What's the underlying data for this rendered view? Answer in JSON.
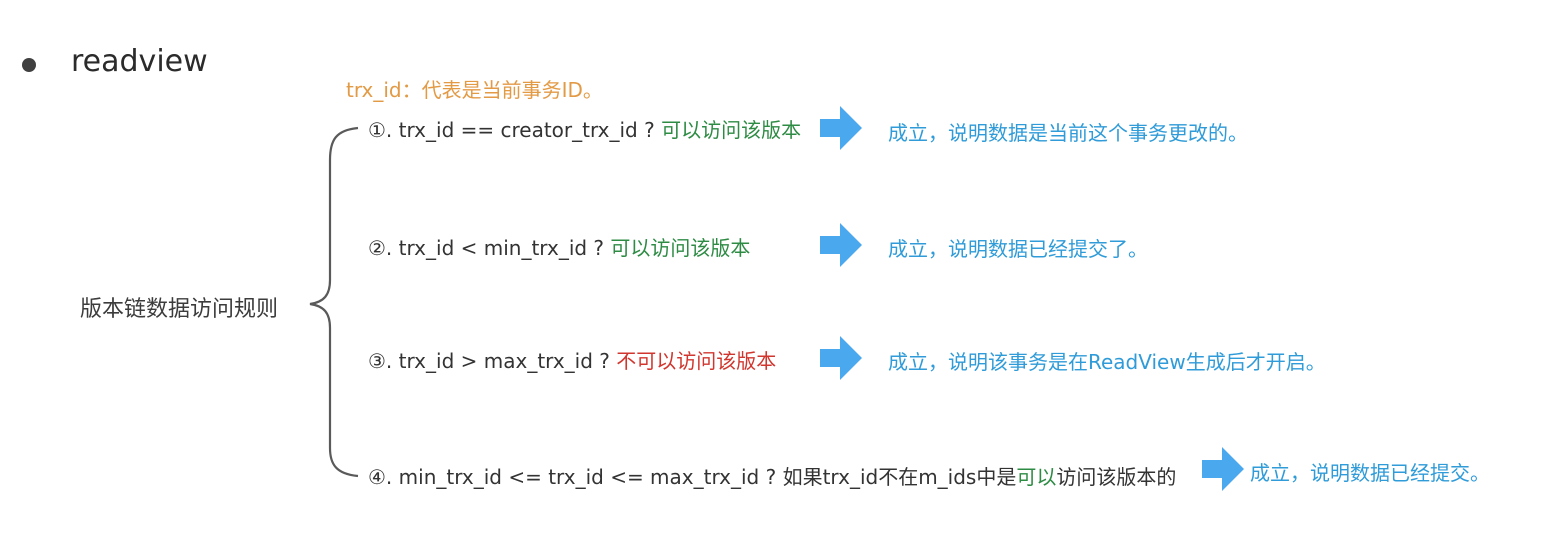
{
  "bullet_title": "readview",
  "note": "trx_id：代表是当前事务ID。",
  "left_label": "版本链数据访问规则",
  "rules": [
    {
      "num": "①.",
      "condition": " trx_id  == creator_trx_id ? ",
      "verdict": "可以访问该版本",
      "result": "成立，说明数据是当前这个事务更改的。"
    },
    {
      "num": "②.",
      "condition": " trx_id < min_trx_id ? ",
      "verdict": "可以访问该版本",
      "result": "成立，说明数据已经提交了。"
    },
    {
      "num": "③.",
      "condition": " trx_id > max_trx_id ?  ",
      "verdict": "不可以访问该版本",
      "result": "成立，说明该事务是在ReadView生成后才开启。"
    },
    {
      "num": "④.",
      "condition": " min_trx_id <= trx_id <= max_trx_id ?  如果trx_id不在m_ids中是",
      "verdict": "可以",
      "tail": "访问该版本的",
      "result": "成立，说明数据已经提交。"
    }
  ],
  "colors": {
    "note": "#e39a45",
    "allowed": "#2e8b44",
    "denied": "#d0362e",
    "result": "#2f9bd8",
    "arrow": "#4aa8ef"
  },
  "icons": {
    "arrow": "right-arrow-icon",
    "bullet": "bullet-dot-icon",
    "brace": "left-curly-brace"
  }
}
